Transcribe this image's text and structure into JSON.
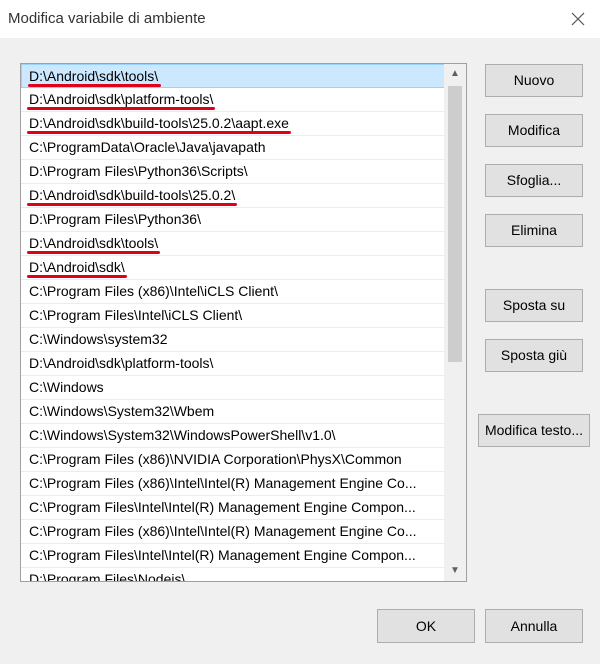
{
  "window": {
    "title": "Modifica variabile di ambiente"
  },
  "paths": [
    "D:\\Android\\sdk\\tools\\",
    "D:\\Android\\sdk\\platform-tools\\",
    "D:\\Android\\sdk\\build-tools\\25.0.2\\aapt.exe",
    "C:\\ProgramData\\Oracle\\Java\\javapath",
    "D:\\Program Files\\Python36\\Scripts\\",
    "D:\\Android\\sdk\\build-tools\\25.0.2\\",
    "D:\\Program Files\\Python36\\",
    "D:\\Android\\sdk\\tools\\",
    "D:\\Android\\sdk\\",
    "C:\\Program Files (x86)\\Intel\\iCLS Client\\",
    "C:\\Program Files\\Intel\\iCLS Client\\",
    "C:\\Windows\\system32",
    "D:\\Android\\sdk\\platform-tools\\",
    "C:\\Windows",
    "C:\\Windows\\System32\\Wbem",
    "C:\\Windows\\System32\\WindowsPowerShell\\v1.0\\",
    "C:\\Program Files (x86)\\NVIDIA Corporation\\PhysX\\Common",
    "C:\\Program Files (x86)\\Intel\\Intel(R) Management Engine Co...",
    "C:\\Program Files\\Intel\\Intel(R) Management Engine Compon...",
    "C:\\Program Files (x86)\\Intel\\Intel(R) Management Engine Co...",
    "C:\\Program Files\\Intel\\Intel(R) Management Engine Compon...",
    "D:\\Program Files\\Nodejs\\"
  ],
  "selected_index": 0,
  "underlined_indices": [
    0,
    1,
    2,
    5,
    7,
    8
  ],
  "underline_color": "#e0001b",
  "selection_color": "#cce8ff",
  "buttons": {
    "new": "Nuovo",
    "edit": "Modifica",
    "browse": "Sfoglia...",
    "delete": "Elimina",
    "move_up": "Sposta su",
    "move_down": "Sposta giù",
    "edit_text": "Modifica testo...",
    "ok": "OK",
    "cancel": "Annulla"
  }
}
